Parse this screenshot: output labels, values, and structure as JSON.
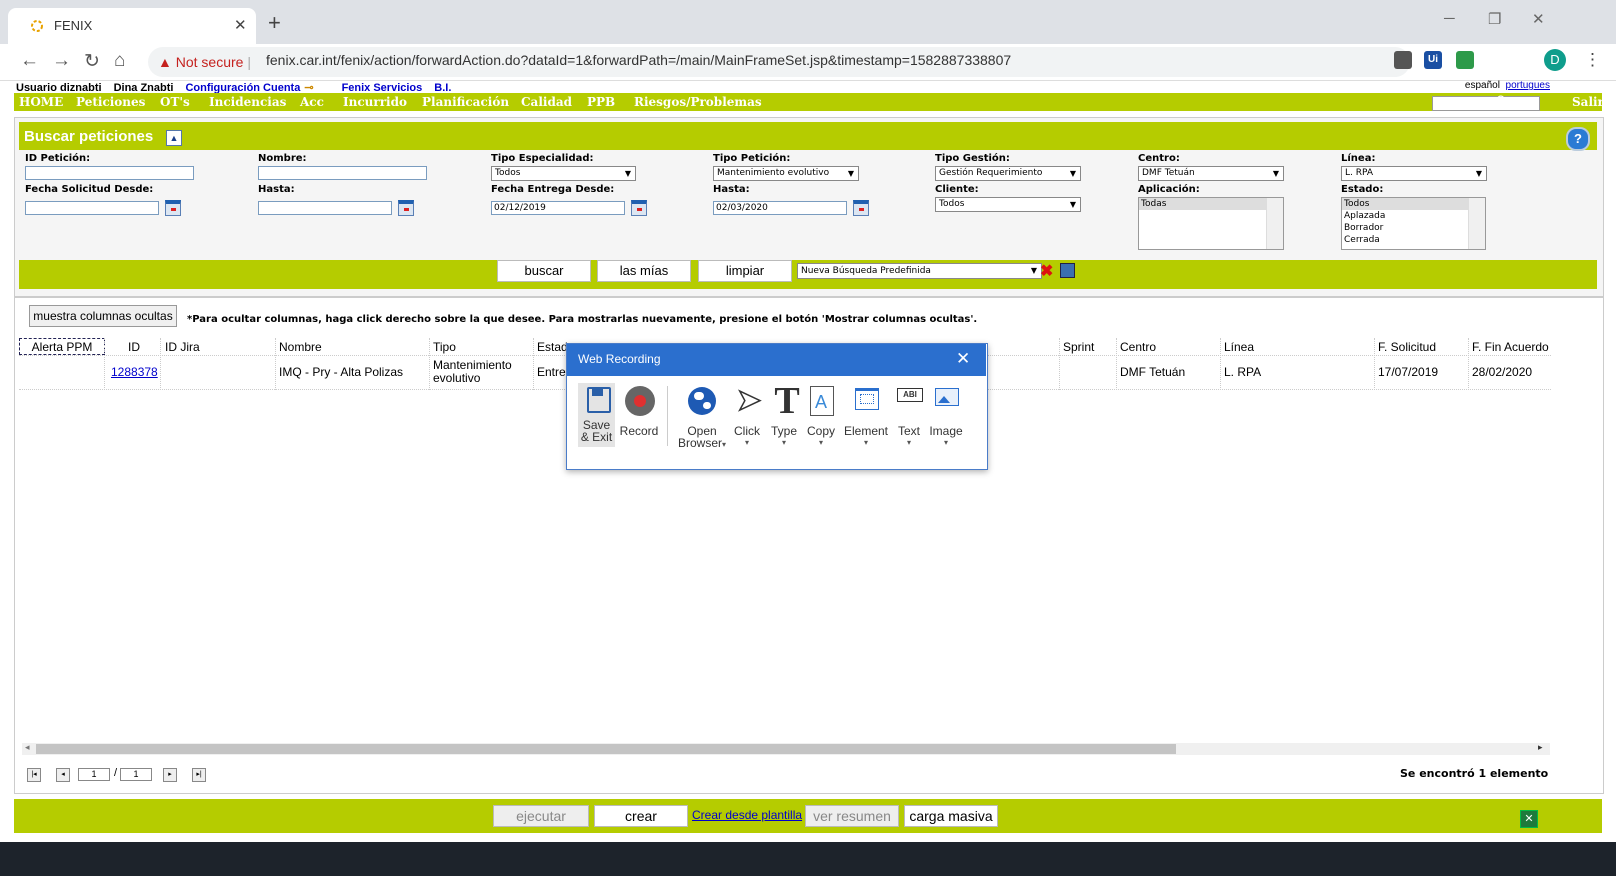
{
  "browser": {
    "tab_title": "FENIX",
    "tab_close": "✕",
    "new_tab": "+",
    "not_secure": "Not secure",
    "url": "fenix.car.int/fenix/action/forwardAction.do?dataId=1&forwardPath=/main/MainFrameSet.jsp&timestamp=1582887338807",
    "avatar_letter": "D",
    "ext_label": "Ui"
  },
  "app": {
    "user_label": "Usuario diznabti",
    "user_name": "Dina Znabti",
    "config": "Configuración Cuenta",
    "fenix_servicios": "Fenix Servicios",
    "bi": "B.I.",
    "lang_es": "español",
    "lang_pt": "portugues",
    "nav": [
      "HOME",
      "Peticiones",
      "OT's",
      "Incidencias",
      "Acc",
      "Incurrido",
      "Planificación",
      "Calidad",
      "PPB",
      "Riesgos/Problemas"
    ],
    "salir": "Salir"
  },
  "search": {
    "title": "Buscar peticiones",
    "help": "?",
    "id_peticion": "ID Petición:",
    "nombre": "Nombre:",
    "tipo_especialidad": "Tipo Especialidad:",
    "tipo_especialidad_val": "Todos",
    "tipo_peticion": "Tipo Petición:",
    "tipo_peticion_val": "Mantenimiento evolutivo",
    "tipo_gestion": "Tipo Gestión:",
    "tipo_gestion_val": "Gestión Requerimiento",
    "centro": "Centro:",
    "centro_val": "DMF Tetuán",
    "linea": "Línea:",
    "linea_val": "L. RPA",
    "fecha_solicitud_desde": "Fecha Solicitud Desde:",
    "hasta": "Hasta:",
    "fecha_entrega_desde": "Fecha Entrega Desde:",
    "fecha_entrega_desde_val": "02/12/2019",
    "hasta2": "Hasta:",
    "hasta2_val": "02/03/2020",
    "cliente": "Cliente:",
    "cliente_val": "Todos",
    "aplicacion": "Aplicación:",
    "aplicacion_opts": [
      "Todas"
    ],
    "estado": "Estado:",
    "estado_opts": [
      "Todos",
      "Aplazada",
      "Borrador",
      "Cerrada"
    ],
    "btn_buscar": "buscar",
    "btn_mias": "las mías",
    "btn_limpiar": "limpiar",
    "predef": "Nueva Búsqueda Predefinida"
  },
  "results": {
    "show_hidden": "muestra columnas ocultas",
    "hint": "*Para ocultar columnas, haga click derecho sobre la que desee. Para mostrarlas nuevamente, presione el botón 'Mostrar columnas ocultas'.",
    "columns": [
      "Alerta PPM",
      "ID",
      "ID Jira",
      "Nombre",
      "Tipo",
      "Estad",
      "Sprint",
      "Centro",
      "Línea",
      "F. Solicitud",
      "F. Fin Acuerdo"
    ],
    "row": {
      "id": "1288378",
      "nombre": "IMQ - Pry - Alta Polizas",
      "tipo_line1": "Mantenimiento",
      "tipo_line2": "evolutivo",
      "estado": "Entre",
      "centro": "DMF Tetuán",
      "linea": "L. RPA",
      "f_solicitud": "17/07/2019",
      "f_fin_acuerdo": "28/02/2020"
    },
    "page_current": "1",
    "page_total": "1",
    "found": "Se encontró 1 elemento"
  },
  "footer": {
    "ejecutar": "ejecutar",
    "crear": "crear",
    "crear_plantilla": "Crear desde plantilla",
    "ver_resumen": "ver resumen",
    "carga_masiva": "carga masiva"
  },
  "dialog": {
    "title": "Web Recording",
    "tools": [
      {
        "l1": "Save",
        "l2": "& Exit"
      },
      {
        "l1": "Record",
        "l2": ""
      },
      {
        "l1": "Open",
        "l2": "Browser"
      },
      {
        "l1": "Click",
        "l2": ""
      },
      {
        "l1": "Type",
        "l2": ""
      },
      {
        "l1": "Copy",
        "l2": ""
      },
      {
        "l1": "Element",
        "l2": ""
      },
      {
        "l1": "Text",
        "l2": ""
      },
      {
        "l1": "Image",
        "l2": ""
      }
    ],
    "abc": "ABI"
  }
}
